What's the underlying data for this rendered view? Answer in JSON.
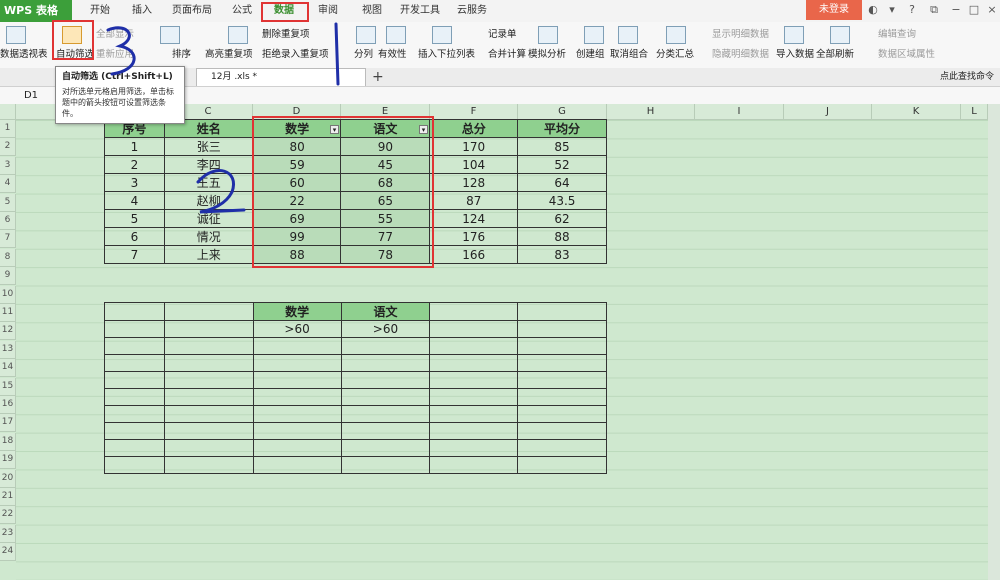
{
  "app": {
    "logo": "WPS 表格",
    "login": "未登录"
  },
  "menu": {
    "tabs": [
      "开始",
      "插入",
      "页面布局",
      "公式",
      "数据",
      "审阅",
      "视图",
      "开发工具",
      "云服务"
    ],
    "active": "数据"
  },
  "ribbon": {
    "pivot": "数据透视表",
    "autofilter": "自动筛选",
    "show_all": "全部显示",
    "reapply": "重新应用",
    "sort": "排序",
    "highlight_dup": "高亮重复项",
    "delete_dup": "删除重复项",
    "reject_dup": "拒绝录入重复项",
    "split": "分列",
    "validity": "有效性",
    "dropdown": "插入下拉列表",
    "record": "记录单",
    "consolidate": "合并计算",
    "simulate": "模拟分析",
    "group": "创建组",
    "ungroup": "取消组合",
    "subtotal": "分类汇总",
    "show_detail": "显示明细数据",
    "hide_detail": "隐藏明细数据",
    "import": "导入数据",
    "refresh_all": "全部刷新",
    "edit_query": "编辑查询",
    "data_props": "数据区域属性"
  },
  "tooltip": {
    "title": "自动筛选 (Ctrl+Shift+L)",
    "body": "对所选单元格启用筛选，单击标题中的箭头按钮可设置筛选条件。"
  },
  "doc_tab": "12月 .xls *",
  "namebox": "D1",
  "find_cmd": "点此查找命令",
  "columns": [
    "C",
    "D",
    "E",
    "F",
    "G",
    "H",
    "I",
    "J",
    "K",
    "L"
  ],
  "rows": [
    "1",
    "2",
    "3",
    "4",
    "5",
    "6",
    "7",
    "8",
    "9",
    "10",
    "11",
    "12",
    "13",
    "14",
    "15",
    "16",
    "17",
    "18",
    "19",
    "20",
    "21",
    "22",
    "23",
    "24"
  ],
  "table1": {
    "headers": [
      "序号",
      "姓名",
      "数学",
      "语文",
      "总分",
      "平均分"
    ],
    "rows": [
      [
        "1",
        "张三",
        "80",
        "90",
        "170",
        "85"
      ],
      [
        "2",
        "李四",
        "59",
        "45",
        "104",
        "52"
      ],
      [
        "3",
        "王五",
        "60",
        "68",
        "128",
        "64"
      ],
      [
        "4",
        "赵柳",
        "22",
        "65",
        "87",
        "43.5"
      ],
      [
        "5",
        "诚征",
        "69",
        "55",
        "124",
        "62"
      ],
      [
        "6",
        "情况",
        "99",
        "77",
        "176",
        "88"
      ],
      [
        "7",
        "上来",
        "88",
        "78",
        "166",
        "83"
      ]
    ]
  },
  "table2": {
    "headers": [
      "数学",
      "语文"
    ],
    "criteria": [
      ">60",
      ">60"
    ]
  }
}
